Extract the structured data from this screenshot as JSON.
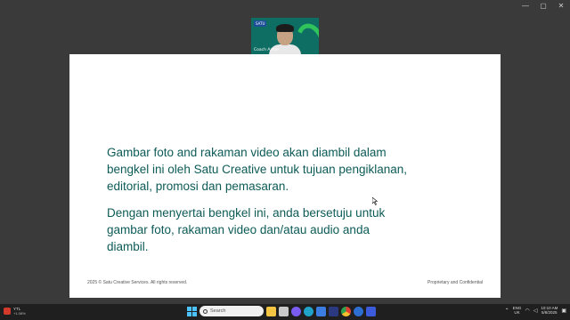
{
  "window": {
    "controls": [
      "—",
      "▢",
      "✕"
    ]
  },
  "video": {
    "participant_name": "Coach Azhar",
    "logo_text": "SATU"
  },
  "slide": {
    "paragraph1": "Gambar foto and rakaman video akan diambil dalam bengkel ini oleh Satu Creative untuk tujuan pengiklanan, editorial, promosi dan pemasaran.",
    "paragraph2": "Dengan menyertai bengkel ini, anda bersetuju untuk gambar foto, rakaman video dan/atau audio anda diambil.",
    "footer_left": "2025 © Satu Creative Services. All rights reserved.",
    "footer_right": "Proprietary and Confidential",
    "text_color": "#0d5b57"
  },
  "taskbar": {
    "weather": {
      "label": "YTL",
      "sub": "+1.08%"
    },
    "search_placeholder": "Search",
    "apps": [
      {
        "name": "file-explorer-icon",
        "color": "#f4c542"
      },
      {
        "name": "media-icon",
        "color": "#c9c9c9"
      },
      {
        "name": "copilot-icon",
        "color": "#7b5cf0"
      },
      {
        "name": "edge-icon",
        "color": "#1fa3c9"
      },
      {
        "name": "photos-icon",
        "color": "#3b7de0"
      },
      {
        "name": "app-icon",
        "color": "#2b3a80"
      },
      {
        "name": "chrome-icon",
        "color": "#e44134"
      },
      {
        "name": "app2-icon",
        "color": "#2d6fd1"
      },
      {
        "name": "zoom-icon",
        "color": "#3b5bdb"
      }
    ],
    "tray": {
      "lang": "ENG",
      "region": "UK",
      "time": "10:10 AM",
      "date": "5/8/2025"
    }
  }
}
